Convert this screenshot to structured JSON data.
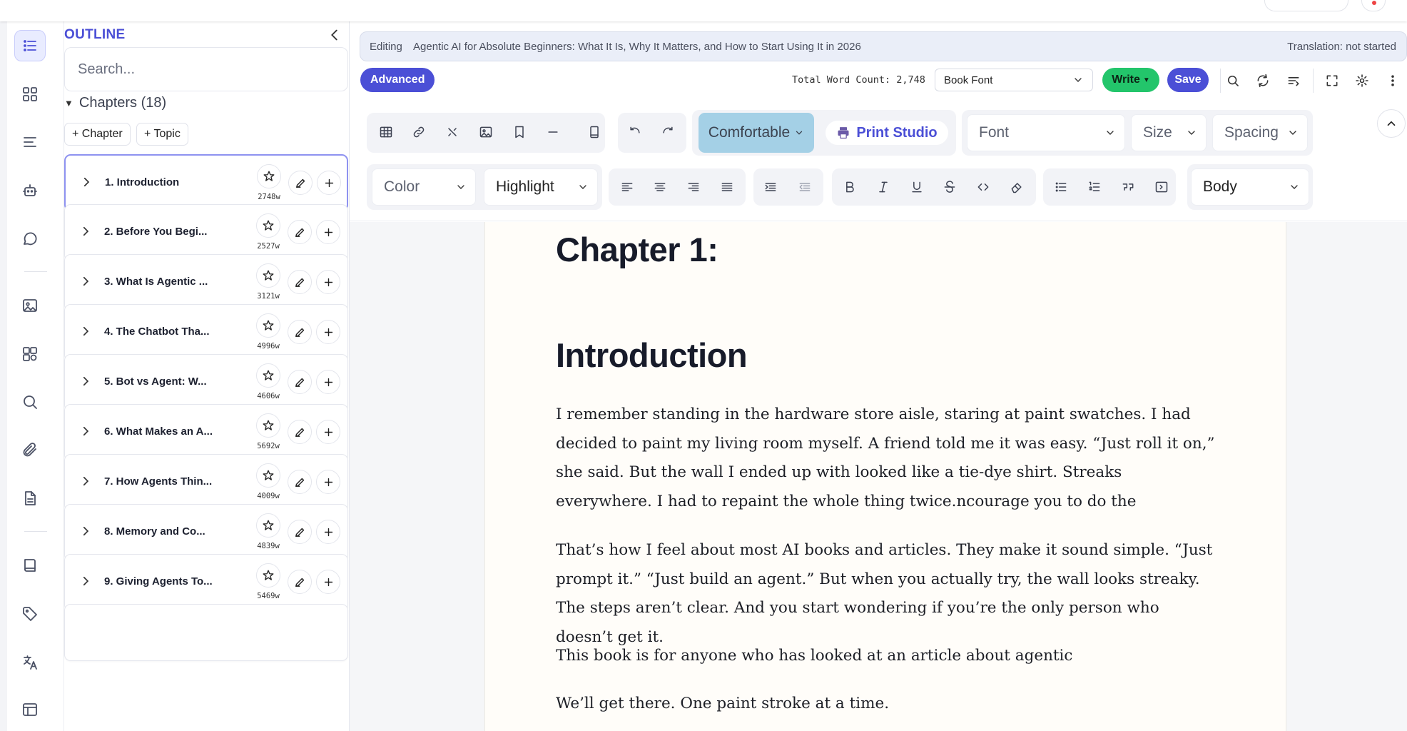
{
  "outline": {
    "title": "OUTLINE",
    "search_placeholder": "Search...",
    "chapters_heading": "Chapters (18)",
    "add_chapter_label": "+ Chapter",
    "add_topic_label": "+ Topic",
    "chapters": [
      {
        "title": "1. Introduction",
        "words": "2748w",
        "active": true
      },
      {
        "title": "2. Before You Begi...",
        "words": "2527w"
      },
      {
        "title": "3. What Is Agentic ...",
        "words": "3121w"
      },
      {
        "title": "4. The Chatbot Tha...",
        "words": "4996w"
      },
      {
        "title": "5. Bot vs Agent: W...",
        "words": "4606w"
      },
      {
        "title": "6. What Makes an A...",
        "words": "5692w"
      },
      {
        "title": "7. How Agents Thin...",
        "words": "4009w"
      },
      {
        "title": "8. Memory and Co...",
        "words": "4839w"
      },
      {
        "title": "9. Giving Agents To...",
        "words": "5469w"
      }
    ]
  },
  "editor": {
    "editing_label": "Editing",
    "document_title": "Agentic AI for Absolute Beginners: What It Is, Why It Matters, and How to Start Using It in 2026",
    "translation_status": "Translation: not started",
    "advanced_label": "Advanced",
    "word_count": "Total Word Count: 2,748",
    "font_select_value": "Book Font",
    "write_label": "Write",
    "save_label": "Save"
  },
  "toolbar": {
    "density_value": "Comfortable",
    "print_studio_label": "Print Studio",
    "font_placeholder": "Font",
    "size_placeholder": "Size",
    "spacing_placeholder": "Spacing",
    "color_placeholder": "Color",
    "highlight_placeholder": "Highlight",
    "block_type_value": "Body"
  },
  "document": {
    "chapter_heading": "Chapter 1:",
    "title_heading": "Introduction",
    "paragraphs": [
      "I remember standing in the hardware store aisle, staring at paint swatches. I had decided to paint my living room myself. A friend told me it was easy. “Just roll it on,” she said. But the wall I ended up with looked like a tie-dye shirt. Streaks everywhere. I had to repaint the whole thing twice.ncourage you to do the",
      "That’s how I feel about most AI books and articles. They make it sound simple. “Just prompt it.” “Just build an agent.” But when you actually try, the wall looks streaky. The steps aren’t clear. And you start wondering if you’re the only person who doesn’t get it.",
      "This book is for anyone who has looked at an article about agentic",
      "We’ll get there. One paint stroke at a time."
    ]
  },
  "colors": {
    "accent": "#4b4fd6",
    "write_green": "#23c56b",
    "density_blue": "#a4d0e6",
    "page_background": "#fffdf9"
  }
}
